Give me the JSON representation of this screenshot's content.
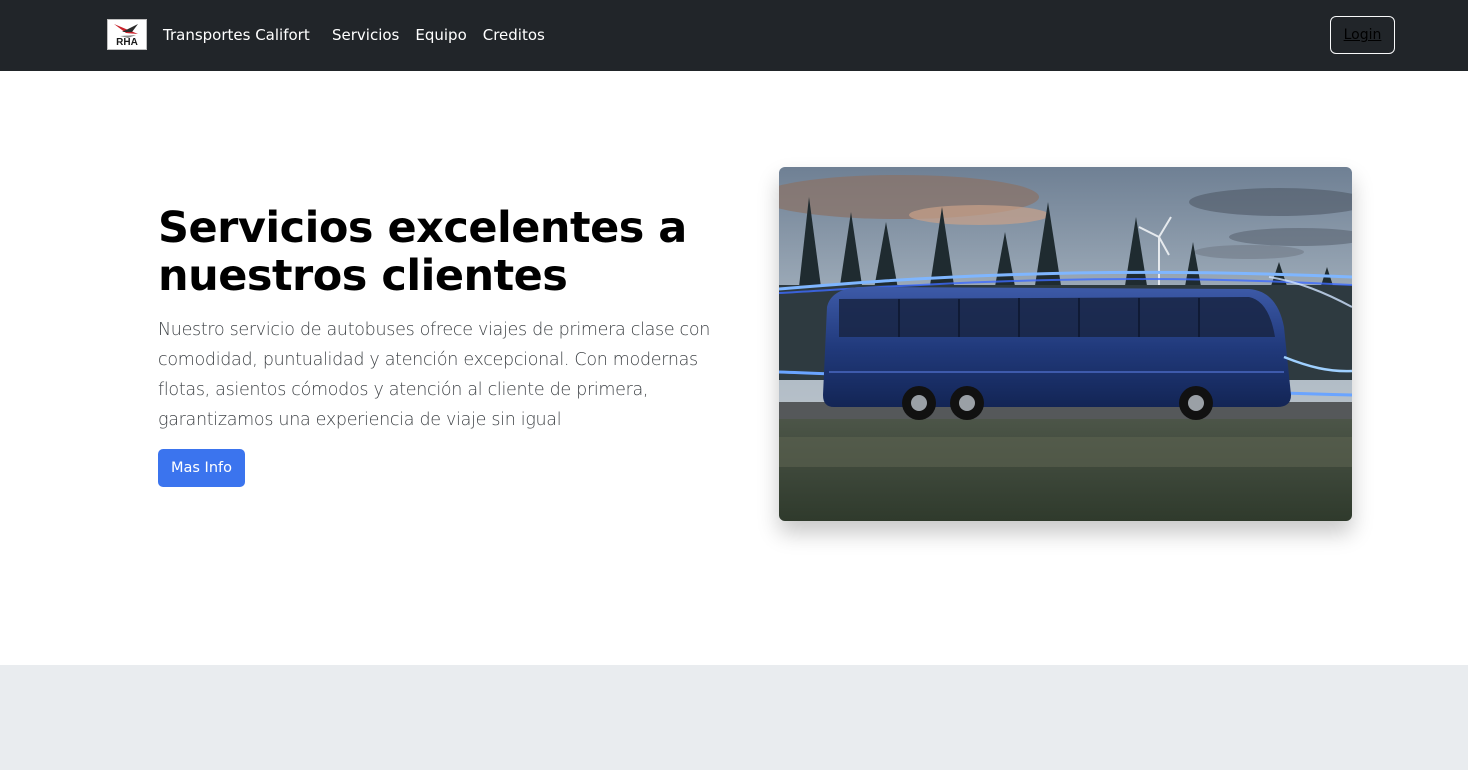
{
  "navbar": {
    "logo_text": "RHA",
    "brand_name": "Transportes Califort",
    "links": [
      "Servicios",
      "Equipo",
      "Creditos"
    ],
    "login_label": "Login"
  },
  "hero": {
    "title": "Servicios excelentes a nuestros clientes",
    "lead": "Nuestro servicio de autobuses ofrece viajes de primera clase con comodidad, puntualidad y atención excepcional. Con modernas flotas, asientos cómodos y atención al cliente de primera, garantizamos una experiencia de viaje sin igual",
    "button_label": "Mas Info"
  },
  "colors": {
    "navbar_bg": "#212529",
    "primary": "#3b74ee",
    "lower_section_bg": "#e9ecef"
  }
}
